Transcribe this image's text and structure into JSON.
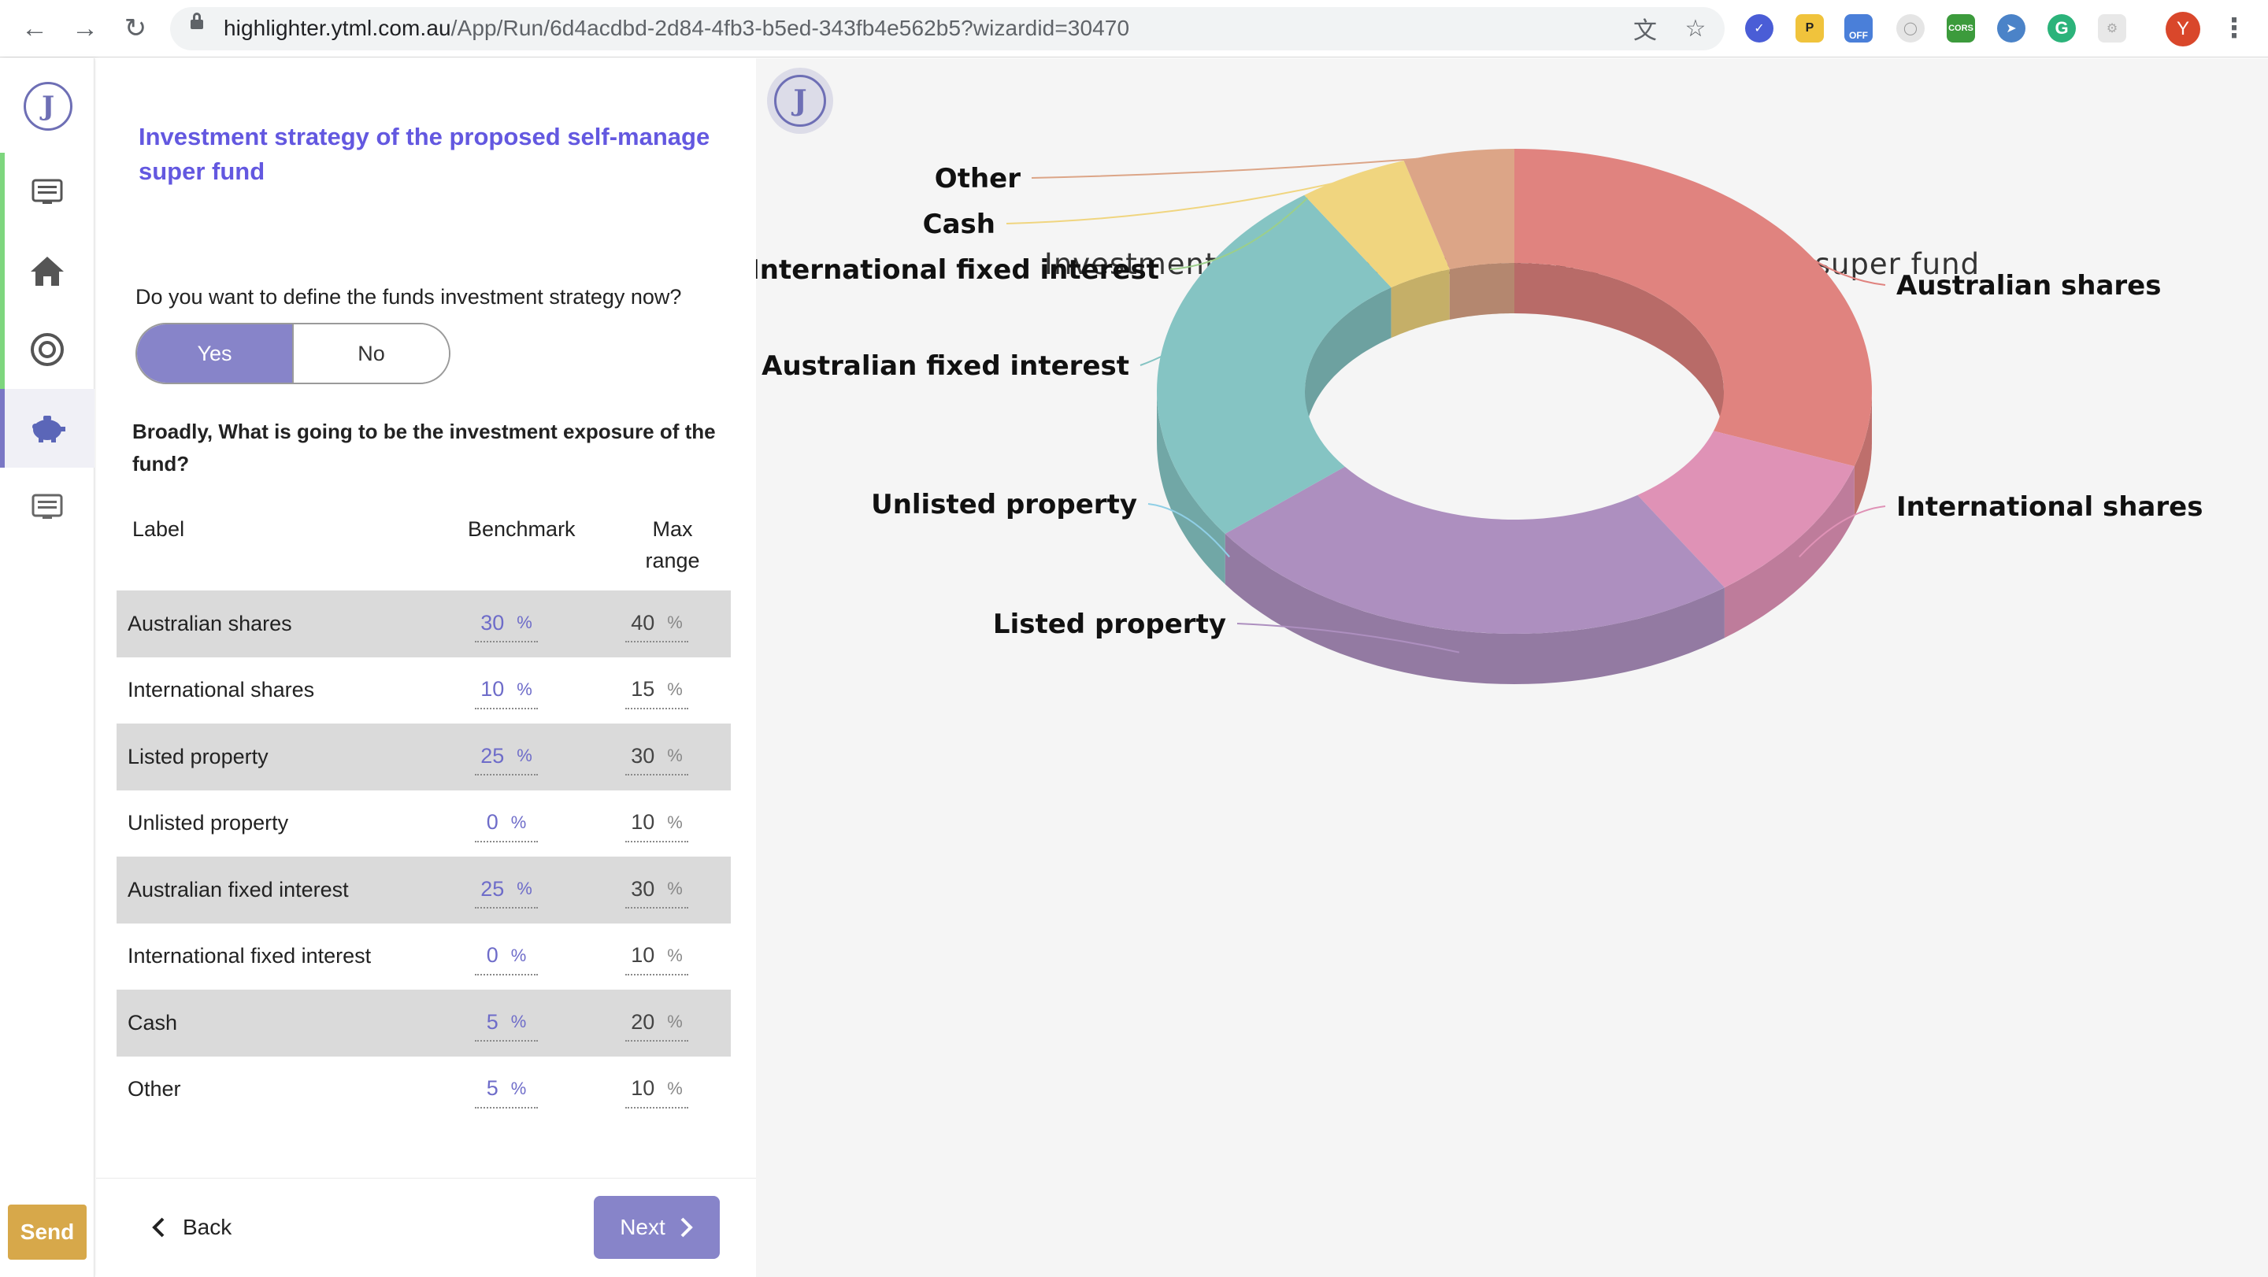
{
  "browser": {
    "url_host": "highlighter.ytml.com.au",
    "url_path": "/App/Run/6d4acdbd-2d84-4fb3-b5ed-343fb4e562b5?wizardid=30470",
    "profile_initial": "Y",
    "extensions": [
      "P",
      "OFF",
      "CORS"
    ]
  },
  "rail": {
    "logo": "J",
    "send_label": "Send",
    "items": [
      "list-icon",
      "home-icon",
      "target-icon",
      "piggy-bank-icon",
      "list-icon"
    ]
  },
  "form": {
    "title": "Investment strategy of the proposed self-manage super fund",
    "question": "Do you want to define the funds investment strategy now?",
    "toggle": {
      "yes": "Yes",
      "no": "No",
      "selected": "Yes"
    },
    "exposure_question": "Broadly, What is going to be the investment exposure of the fund?",
    "columns": {
      "label": "Label",
      "benchmark": "Benchmark",
      "max": "Max range"
    },
    "percent_sign": "%",
    "rows": [
      {
        "label": "Australian shares",
        "benchmark": "30",
        "max": "40"
      },
      {
        "label": "International shares",
        "benchmark": "10",
        "max": "15"
      },
      {
        "label": "Listed property",
        "benchmark": "25",
        "max": "30"
      },
      {
        "label": "Unlisted property",
        "benchmark": "0",
        "max": "10"
      },
      {
        "label": "Australian fixed interest",
        "benchmark": "25",
        "max": "30"
      },
      {
        "label": "International fixed interest",
        "benchmark": "0",
        "max": "10"
      },
      {
        "label": "Cash",
        "benchmark": "5",
        "max": "20"
      },
      {
        "label": "Other",
        "benchmark": "5",
        "max": "10"
      }
    ],
    "back_label": "Back",
    "next_label": "Next"
  },
  "chart_data": {
    "type": "pie",
    "title": "Investment strategy of the proposed self-manage super fund",
    "donut": true,
    "three_d": true,
    "slices": [
      {
        "label": "Australian shares",
        "value": 30,
        "color": "#e0837f"
      },
      {
        "label": "International shares",
        "value": 10,
        "color": "#df92b6"
      },
      {
        "label": "Listed property",
        "value": 25,
        "color": "#ad8fbf"
      },
      {
        "label": "Unlisted property",
        "value": 0,
        "color": "#8fcfe6"
      },
      {
        "label": "Australian fixed interest",
        "value": 25,
        "color": "#85c4c3"
      },
      {
        "label": "International fixed interest",
        "value": 0,
        "color": "#9ccf8a"
      },
      {
        "label": "Cash",
        "value": 5,
        "color": "#f0d57f"
      },
      {
        "label": "Other",
        "value": 5,
        "color": "#dca587"
      }
    ]
  },
  "chart_logo": "J"
}
